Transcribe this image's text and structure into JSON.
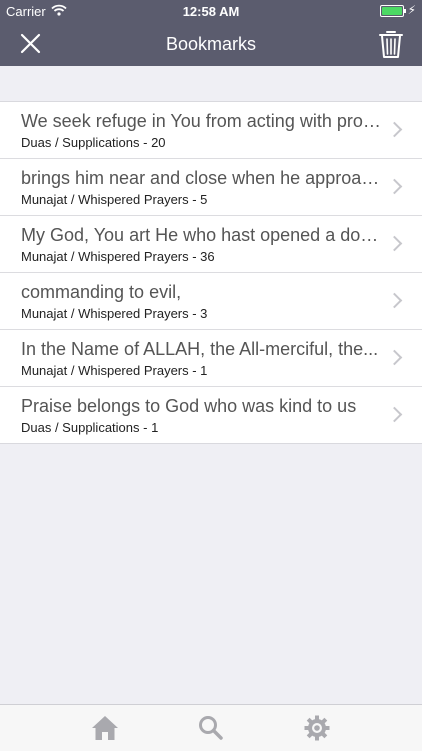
{
  "status_bar": {
    "carrier": "Carrier",
    "time": "12:58 AM"
  },
  "navbar": {
    "title": "Bookmarks"
  },
  "bookmarks": [
    {
      "title": "We seek refuge in You from acting with prodi...",
      "subtitle": "Duas / Supplications - 20"
    },
    {
      "title": "brings him near and close when he approach...",
      "subtitle": "Munajat / Whispered Prayers - 5"
    },
    {
      "title": "My God, You art He who hast opened a door...",
      "subtitle": "Munajat / Whispered Prayers - 36"
    },
    {
      "title": "commanding to evil,",
      "subtitle": "Munajat / Whispered Prayers - 3"
    },
    {
      "title": "In the Name of ALLAH, the All-merciful, the...",
      "subtitle": "Munajat / Whispered Prayers - 1"
    },
    {
      "title": "Praise belongs to God who was kind to us",
      "subtitle": "Duas / Supplications - 1"
    }
  ],
  "tabbar": {
    "icons": [
      "home-icon",
      "search-icon",
      "gear-icon"
    ]
  },
  "colors": {
    "navbar": "#5b5c6e",
    "background": "#efeff4",
    "battery": "#4cd964",
    "tab_icon": "#a9a9ae"
  }
}
